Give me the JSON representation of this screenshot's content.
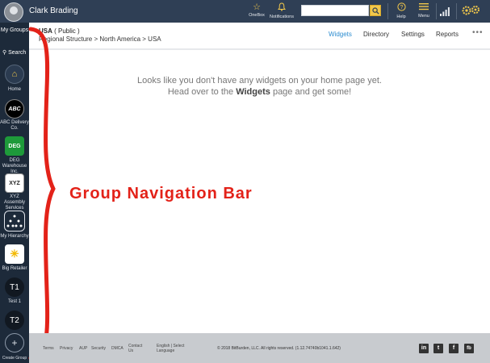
{
  "topbar": {
    "user_name": "Clark Brading",
    "onebox_label": "OneBox",
    "notifications_label": "Notifications",
    "search_placeholder": "",
    "help_label": "Help",
    "menu_label": "Menu"
  },
  "rail": {
    "my_groups": "My Groups",
    "search": "Search",
    "items": [
      {
        "label": "Home",
        "icon": "home-icon"
      },
      {
        "label": "ABC Delivery Co.",
        "logo": "ABC"
      },
      {
        "label": "DEG Warehouse Inc.",
        "logo": "DEG"
      },
      {
        "label": "XYZ Assembly Services",
        "logo": "XYZ"
      },
      {
        "label": "My Hierarchy",
        "icon": "hierarchy-icon"
      },
      {
        "label": "Big Retailer",
        "icon": "spark-icon"
      },
      {
        "label": "Test 1",
        "logo": "T1"
      },
      {
        "label": "",
        "logo": "T2"
      },
      {
        "label": "Create Group",
        "icon": "plus-icon"
      }
    ]
  },
  "annotation": {
    "label": "Group Navigation Bar",
    "color": "#e32219"
  },
  "header": {
    "title": "USA",
    "title_suffix": "( Public )",
    "breadcrumb": "Regional Structure > North America > USA",
    "tabs": [
      {
        "label": "Widgets",
        "active": true
      },
      {
        "label": "Directory",
        "active": false
      },
      {
        "label": "Settings",
        "active": false
      },
      {
        "label": "Reports",
        "active": false
      }
    ],
    "more": "•••"
  },
  "main": {
    "empty_line1": "Looks like you don't have any widgets on your home page yet.",
    "empty_line2_pre": "Head over to the ",
    "empty_line2_bold": "Widgets",
    "empty_line2_post": " page and get some!"
  },
  "footer": {
    "links": [
      "Terms",
      "Privacy",
      "AUP",
      "Security",
      "DMCA",
      "Contact Us",
      "English | Select Language"
    ],
    "copyright": "© 2018 BitBurden, LLC. All rights reserved. (1.12.74740b1041.1.642)",
    "social": [
      "in",
      "t",
      "f",
      "fb"
    ]
  },
  "colors": {
    "topbar": "#2f3f55",
    "rail": "#1d2a3a",
    "accent": "#2d8dd0",
    "icon_yellow": "#f2c84b"
  }
}
